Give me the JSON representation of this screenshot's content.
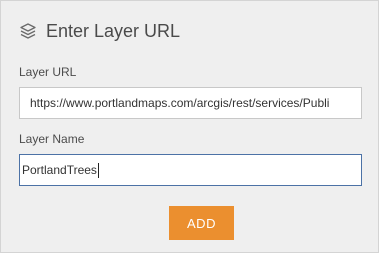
{
  "header": {
    "title": "Enter Layer URL",
    "icon": "layers-icon"
  },
  "form": {
    "url_label": "Layer URL",
    "url_value": "https://www.portlandmaps.com/arcgis/rest/services/Publi",
    "name_label": "Layer Name",
    "name_value": "PortlandTrees",
    "add_label": "ADD"
  },
  "colors": {
    "panel_background": "#efefef",
    "accent_button": "#eb8f2f",
    "focused_field_border": "#4c72a6"
  }
}
